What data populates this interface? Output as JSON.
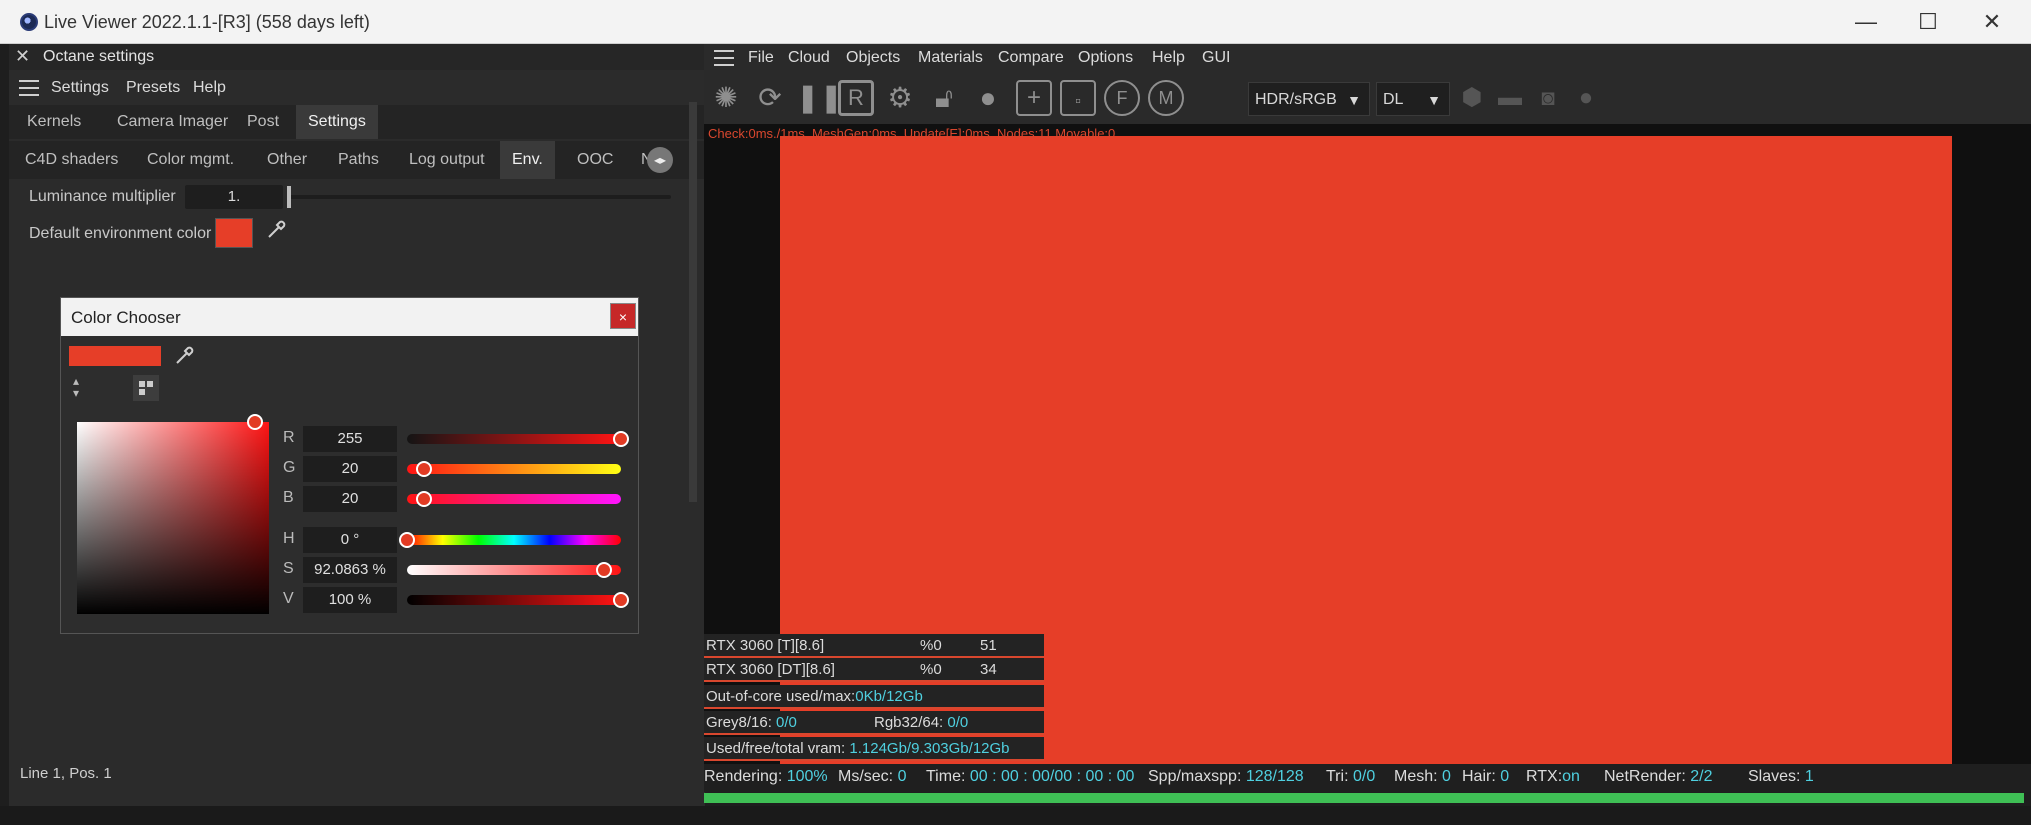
{
  "window": {
    "title": "Live Viewer 2022.1.1-[R3] (558 days left)",
    "minimize": "—",
    "maximize": "☐",
    "close": "✕"
  },
  "octane_settings": {
    "header": "Octane settings",
    "menu": [
      "Settings",
      "Presets",
      "Help"
    ],
    "tabs_row1": [
      "Kernels",
      "Camera Imager",
      "Post",
      "Settings"
    ],
    "tabs_row1_active": "Settings",
    "tabs_row2": [
      "C4D shaders",
      "Color mgmt.",
      "Other",
      "Paths",
      "Log output",
      "Env.",
      "OOC",
      "Ne"
    ],
    "tabs_row2_active": "Env.",
    "luminance_label": "Luminance multiplier",
    "luminance_value": "1.",
    "default_env_label": "Default environment color",
    "env_color": "#e63e28"
  },
  "color_chooser": {
    "title": "Color Chooser",
    "close": "×",
    "swatch": "#e63e28",
    "channels": {
      "r": {
        "label": "R",
        "value": "255",
        "fraction": 1.0
      },
      "g": {
        "label": "G",
        "value": "20",
        "fraction": 0.08
      },
      "b": {
        "label": "B",
        "value": "20",
        "fraction": 0.08
      },
      "h": {
        "label": "H",
        "value": "0 °",
        "fraction": 0.0
      },
      "s": {
        "label": "S",
        "value": "92.0863 %",
        "fraction": 0.92
      },
      "v": {
        "label": "V",
        "value": "100 %",
        "fraction": 1.0
      }
    }
  },
  "left_status": "Line 1, Pos. 1",
  "viewer": {
    "menu": [
      "File",
      "Cloud",
      "Objects",
      "Materials",
      "Compare",
      "Options",
      "Help",
      "GUI"
    ],
    "display_mode": "HDR/sRGB",
    "kernel_mode": "DL",
    "overlay": "Check:0ms./1ms. MeshGen:0ms. Update[E]:0ms. Nodes:11 Movable:0",
    "render_color": "#e63e28"
  },
  "gpu_stats": [
    {
      "name": "RTX 3060 [T][8.6]",
      "pct": "%0",
      "temp": "51"
    },
    {
      "name": "RTX 3060 [DT][8.6]",
      "pct": "%0",
      "temp": "34"
    }
  ],
  "memory": {
    "ooc_label": "Out-of-core used/max:",
    "ooc_value": "0Kb/12Gb",
    "grey_label": "Grey8/16:",
    "grey_value": "0/0",
    "rgb_label": "Rgb32/64:",
    "rgb_value": "0/0",
    "vram_label": "Used/free/total vram:",
    "vram_value": "1.124Gb/9.303Gb/12Gb"
  },
  "status": {
    "rendering_label": "Rendering:",
    "rendering_value": "100%",
    "mssec_label": "Ms/sec:",
    "mssec_value": "0",
    "time_label": "Time:",
    "time_value": "00 : 00 : 00/00 : 00 : 00",
    "spp_label": "Spp/maxspp:",
    "spp_value": "128/128",
    "tri_label": "Tri:",
    "tri_value": "0/0",
    "mesh_label": "Mesh:",
    "mesh_value": "0",
    "hair_label": "Hair:",
    "hair_value": "0",
    "rtx_label": "RTX:",
    "rtx_value": "on",
    "netrender_label": "NetRender:",
    "netrender_value": "2/2",
    "slaves_label": "Slaves:",
    "slaves_value": "1",
    "progress": 1.0
  }
}
